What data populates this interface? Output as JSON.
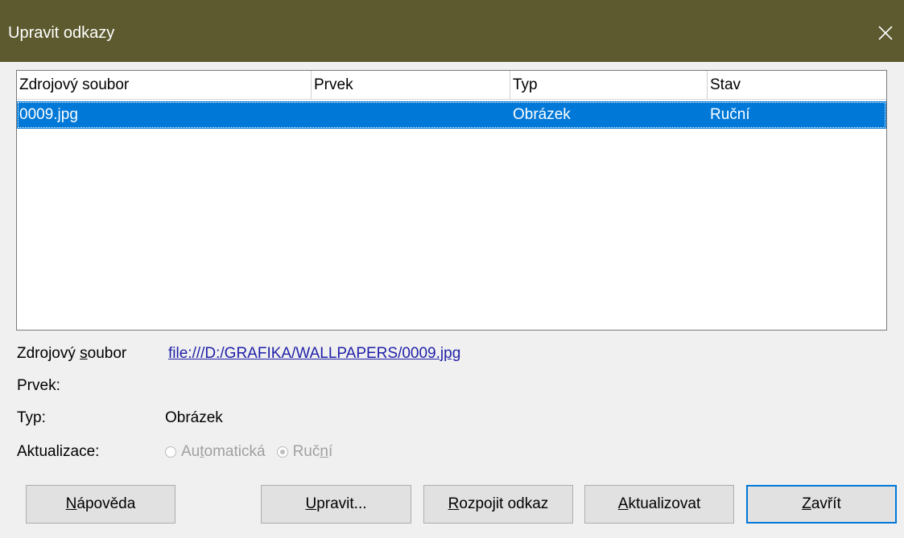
{
  "window": {
    "title": "Upravit odkazy",
    "close_glyph": "✕"
  },
  "list": {
    "columns": [
      "Zdrojový soubor",
      "Prvek",
      "Typ",
      "Stav"
    ],
    "rows": [
      {
        "source": "0009.jpg",
        "element": "",
        "type": "Obrázek",
        "status": "Ruční",
        "selected": true
      }
    ]
  },
  "details": {
    "source_label_pre": "Zdrojový ",
    "source_label_ul": "s",
    "source_label_post": "oubor",
    "source_value": "file:///D:/GRAFIKA/WALLPAPERS/0009.jpg",
    "element_label": "Prvek:",
    "element_value": "",
    "type_label": "Typ:",
    "type_value": "Obrázek",
    "update_label": "Aktualizace:",
    "update_auto_pre": "Au",
    "update_auto_ul": "t",
    "update_auto_post": "omatická",
    "update_manual_pre": "Ruč",
    "update_manual_ul": "n",
    "update_manual_post": "í",
    "update_selected": "Ruční"
  },
  "buttons": {
    "help_ul": "N",
    "help_rest": "ápověda",
    "edit_ul": "U",
    "edit_rest": "pravit...",
    "break_ul": "R",
    "break_rest": "ozpojit odkaz",
    "update_ul": "A",
    "update_rest": "ktualizovat",
    "close_ul": "Z",
    "close_rest": "avřít"
  },
  "colors": {
    "titlebar": "#5c5a2e",
    "selection": "#0078d7",
    "link": "#1f1fa8",
    "dialog_bg": "#f0f0f0"
  }
}
